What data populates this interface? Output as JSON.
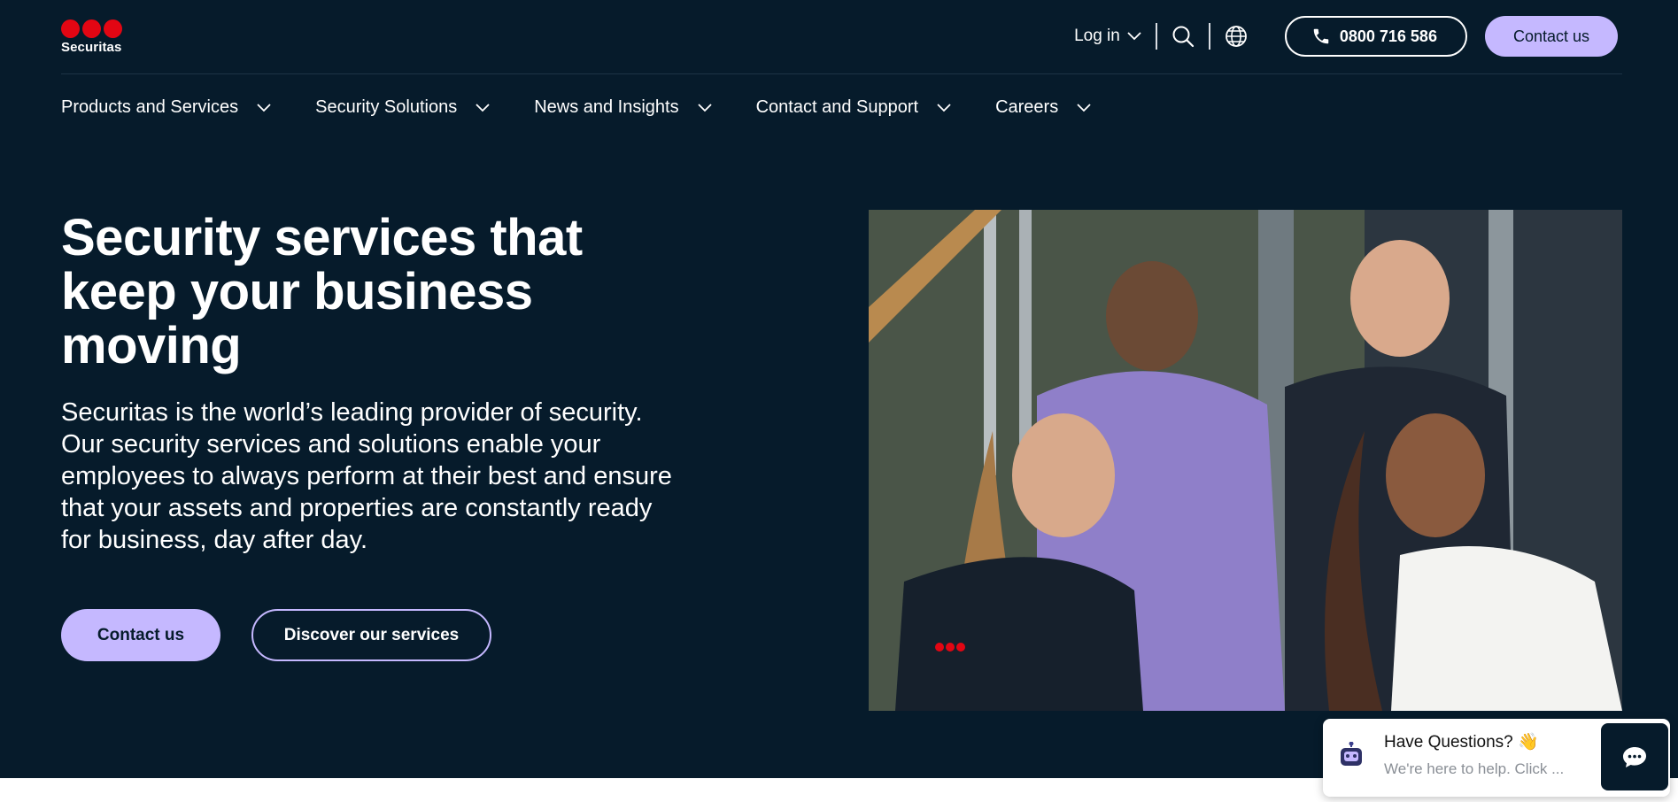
{
  "brand": {
    "name": "Securitas",
    "accent": "#e30613",
    "dark": "#061b2b",
    "lavender": "#c5b8ff"
  },
  "utility": {
    "login_label": "Log in",
    "search_icon": "search-icon",
    "language_icon": "globe-icon",
    "phone_number": "0800 716 586",
    "contact_label": "Contact us"
  },
  "nav": {
    "items": [
      {
        "label": "Products and Services"
      },
      {
        "label": "Security Solutions"
      },
      {
        "label": "News and Insights"
      },
      {
        "label": "Contact and Support"
      },
      {
        "label": "Careers"
      }
    ]
  },
  "hero": {
    "headline": "Security services that keep your business moving",
    "lead": "Securitas is the world’s leading provider of security. Our security services and solutions enable your employees to always perform at their best and ensure that your assets and properties are constantly ready for business, day after day.",
    "primary_cta": "Contact us",
    "secondary_cta": "Discover our services",
    "image_alt": "four-colleagues-talking-photo"
  },
  "chat": {
    "title": "Have Questions? 👋",
    "subtitle": "We're here to help. Click ..."
  }
}
